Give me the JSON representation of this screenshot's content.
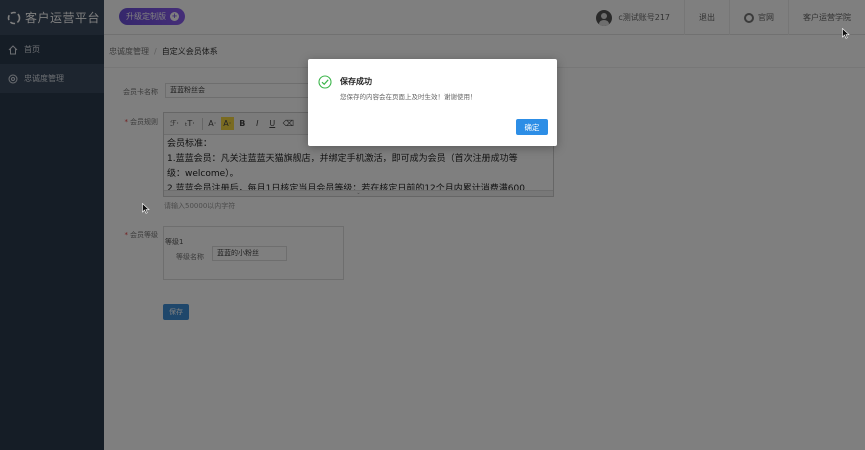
{
  "app": {
    "title": "客户运营平台",
    "upgrade_label": "升级定制版",
    "upgrade_plus": "+"
  },
  "header": {
    "account": "c测试账号217",
    "logout": "退出",
    "official_site": "官网",
    "academy": "客户运营学院"
  },
  "sidebar": {
    "items": [
      {
        "label": "首页",
        "icon": "home-icon"
      },
      {
        "label": "忠诚度管理",
        "icon": "loyalty-icon"
      }
    ]
  },
  "breadcrumb": {
    "parent": "忠诚度管理",
    "separator": "/",
    "current": "自定义会员体系"
  },
  "form": {
    "card_name_label": "会员卡名称",
    "card_name_value": "蓝蓝粉丝会",
    "rules_label": "会员规则",
    "required_mark": "*",
    "toolbar": {
      "font_family": "ℱ·",
      "font_size": "ₜT·",
      "font_color": "A·",
      "bg_color": "A·",
      "bold": "B",
      "italic": "I",
      "underline": "U",
      "eraser": "⌫"
    },
    "editor_lines": [
      "会员标准：",
      "1.蓝蓝会员：凡关注蓝蓝天猫旗舰店，并绑定手机激活，即可成为会员（首次注册成功等",
      "级：welcome）。",
      "2.蓝蓝会员注册后，每月1日核定当月会员等级：若在核定日前的12个月内累计消费满600"
    ],
    "editor_resize": "⌄",
    "hint": "请输入50000以内字符",
    "level_label": "会员等级",
    "level_title": "等级1",
    "level_name_label": "等级名称",
    "level_name_value": "蓝蓝的小粉丝",
    "save": "保存"
  },
  "modal": {
    "title": "保存成功",
    "message": "您保存的内容会在页面上及时生效！谢谢使用！",
    "ok": "确定"
  },
  "colors": {
    "sidebar_bg": "#2b3a4d",
    "accent": "#2d8ee6",
    "badge": "#7a55e6",
    "success": "#3bb54a"
  }
}
